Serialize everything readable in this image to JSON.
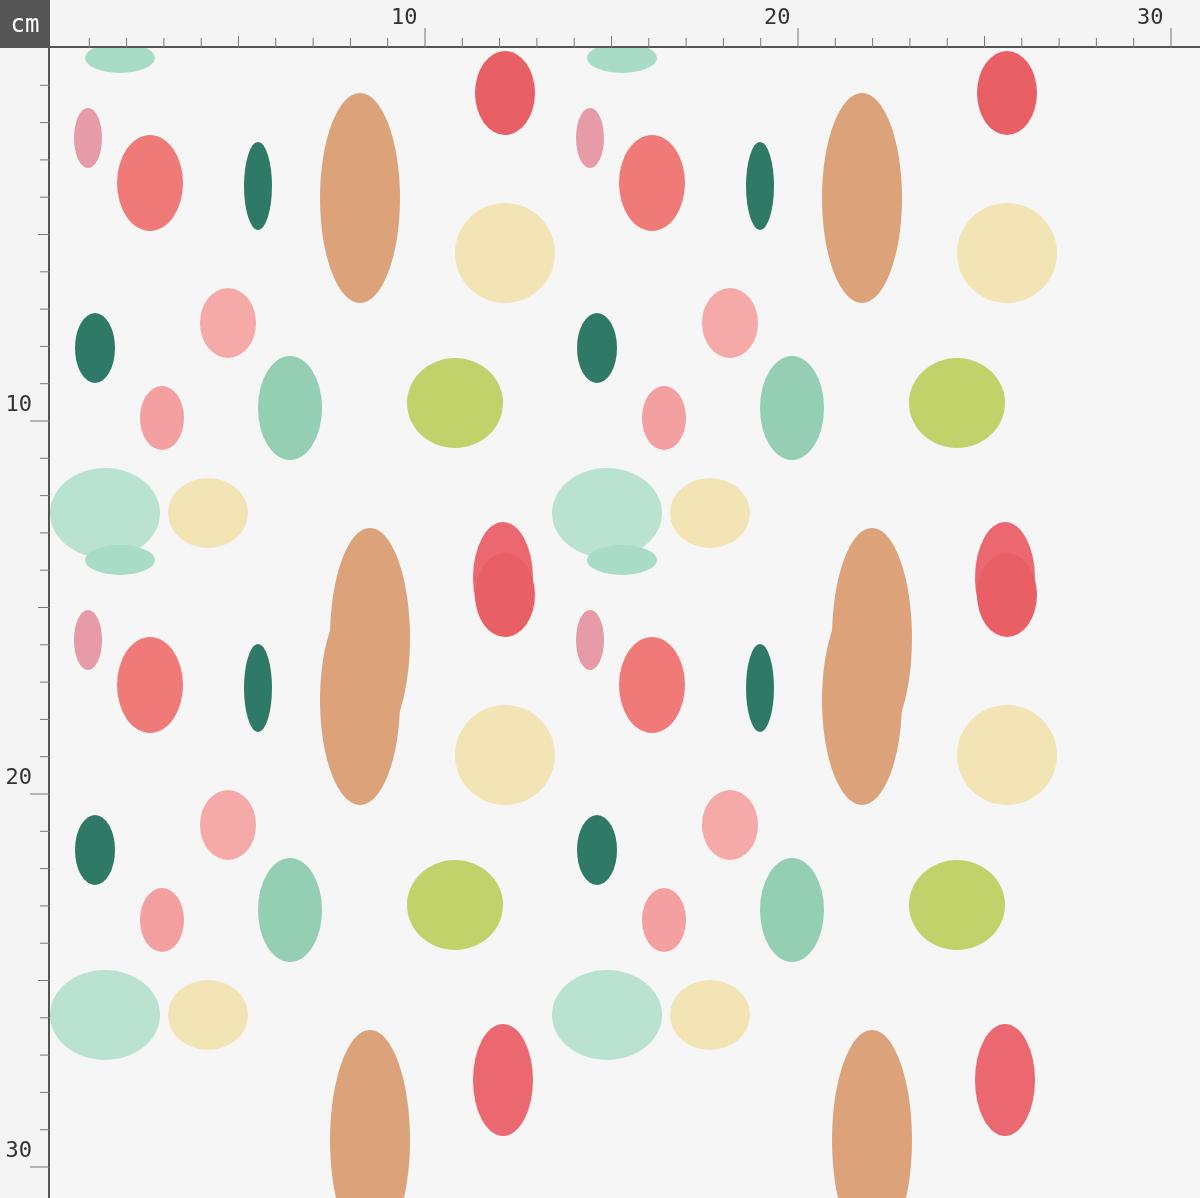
{
  "ruler": {
    "unit": "cm",
    "top_labels": [
      "10",
      "20",
      "30"
    ],
    "left_labels": [
      "10",
      "20",
      "30"
    ]
  }
}
